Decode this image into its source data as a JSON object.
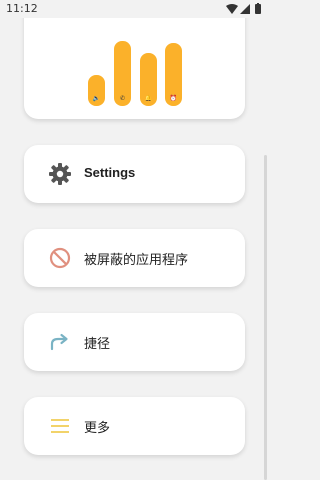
{
  "status_bar": {
    "time": "11:12",
    "icons": [
      "wifi-icon",
      "cellular-signal-icon",
      "battery-icon"
    ]
  },
  "volume_panel": {
    "sliders": [
      {
        "name": "media",
        "icon": "speaker-icon",
        "glyph": "🔈",
        "level": 0.45
      },
      {
        "name": "call",
        "icon": "phone-icon",
        "glyph": "✆",
        "level": 0.95
      },
      {
        "name": "ring",
        "icon": "bell-icon",
        "glyph": "🔔",
        "level": 0.78
      },
      {
        "name": "alarm",
        "icon": "alarm-clock-icon",
        "glyph": "⏰",
        "level": 0.92
      }
    ],
    "bar_color": "#fbb12a"
  },
  "menu": {
    "settings": {
      "label": "Settings",
      "icon": "gear-icon",
      "color": "#555555"
    },
    "blocked_apps": {
      "label": "被屏蔽的应用程序",
      "icon": "block-icon",
      "color": "#e0907f"
    },
    "shortcuts": {
      "label": "捷径",
      "icon": "share-arrow-icon",
      "color": "#7ab3c4"
    },
    "more": {
      "label": "更多",
      "icon": "menu-lines-icon",
      "color": "#f2d36a"
    }
  }
}
